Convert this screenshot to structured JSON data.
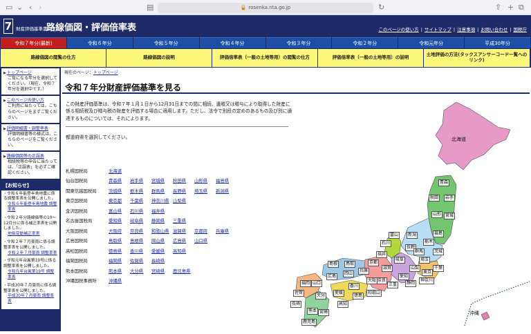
{
  "browser": {
    "url": "rosenka.nta.go.jp"
  },
  "header": {
    "logo_number": "7",
    "site_subtitle": "財産評価基準書",
    "site_title": "路線価図・評価倍率表",
    "util_links": [
      "このページの使い方",
      "サイトマップ",
      "注意事項",
      "お問い合わせ",
      "国税庁"
    ]
  },
  "year_tabs": [
    {
      "label": "令和７年分(最新)",
      "active": true
    },
    {
      "label": "令和６年分"
    },
    {
      "label": "令和５年分"
    },
    {
      "label": "令和４年分"
    },
    {
      "label": "令和３年分"
    },
    {
      "label": "令和２年分"
    },
    {
      "label": "令和元年分"
    },
    {
      "label": "平成30年分"
    }
  ],
  "menu": [
    "路線価図の閲覧の仕方",
    "路線価図の説明",
    "評価倍率表（一般の土地等用）の閲覧の仕方",
    "評価倍率表（一般の土地等用）の説明",
    "土地評価の方法(タックスアンサーコード一覧へのリンク)"
  ],
  "sidebar": {
    "boxes": [
      {
        "title": "トップページ",
        "desc": "ご覧になる年分を選択してください。（現在、令和７年分を選択中です。）"
      },
      {
        "title": "このページの使い方",
        "desc": "ご利用に当たっては、こちらのページをまずご覧ください。"
      },
      {
        "title": "評価明細書・調整率表",
        "desc": "評価明細書等の様式は、こちらのページをご覧ください。"
      },
      {
        "title": "路線価図等の正誤表",
        "desc": "相続税等の申告に当たっては、「正誤表」を必ずご確認ください。"
      }
    ],
    "news_heading": "【お知らせ】",
    "news": [
      {
        "text": "令和６年能登半島地震に係る調整率表を公開しました。",
        "link": "令和６年能登半島地震 調整率表"
      },
      {
        "text": "令和２年分路線価等の10～12月分に係る補正率表を公開しました。",
        "link": "地価変動補正率表"
      },
      {
        "text": "令和２年７月豪雨に係る調整率表を公開しました。",
        "link": "令和２年７月豪雨 調整率表"
      },
      {
        "text": "令和元年台風第19号に係る調整率表を公開しました。",
        "link": "令和元年台風第19号 調整率表"
      },
      {
        "text": "平成30年７月豪雨に係る調整率表を公開しました。",
        "link": "平成30年７月豪雨 調整率表"
      }
    ]
  },
  "main": {
    "breadcrumb_prefix": "現在のページ：",
    "breadcrumb_link": "トップページ",
    "title": "令和７年分財産評価基準を見る",
    "intro": "この財産評価基準は、令和７年１月１日から12月31日までの間に相続、遺贈又は贈与により取得した財産に係る相続税及び贈与税の財産を評価する場合に適用します。ただし、法令で別段の定めのあるもの及び別に通達するものについては、それによります。",
    "select_prompt": "都道府県を選択してください。"
  },
  "bureaus": [
    {
      "name": "札幌国税局",
      "prefs": [
        "北海道"
      ]
    },
    {
      "name": "仙台国税局",
      "prefs": [
        "青森県",
        "岩手県",
        "宮城県",
        "秋田県",
        "山形県",
        "福島県"
      ]
    },
    {
      "name": "関東信越国税局",
      "prefs": [
        "茨城県",
        "栃木県",
        "群馬県",
        "長野県",
        "埼玉県",
        "新潟県"
      ]
    },
    {
      "name": "東京国税局",
      "prefs": [
        "東京都",
        "千葉県",
        "神奈川県",
        "山梨県"
      ]
    },
    {
      "name": "金沢国税局",
      "prefs": [
        "富山県",
        "石川県",
        "福井県"
      ]
    },
    {
      "name": "名古屋国税局",
      "prefs": [
        "愛知県",
        "岐阜県",
        "静岡県",
        "三重県"
      ]
    },
    {
      "name": "大阪国税局",
      "prefs": [
        "大阪府",
        "奈良県",
        "和歌山県",
        "滋賀県",
        "京都府",
        "兵庫県"
      ]
    },
    {
      "name": "広島国税局",
      "prefs": [
        "鳥取県",
        "島根県",
        "岡山県",
        "広島県",
        "山口県"
      ]
    },
    {
      "name": "高松国税局",
      "prefs": [
        "徳島県",
        "香川県",
        "愛媛県",
        "高知県"
      ]
    },
    {
      "name": "福岡国税局",
      "prefs": [
        "福岡県",
        "佐賀県",
        "長崎県"
      ]
    },
    {
      "name": "熊本国税局",
      "prefs": [
        "熊本県",
        "大分県",
        "宮崎県",
        "鹿児島県"
      ]
    },
    {
      "name": "沖縄国税事務所",
      "prefs": [
        "沖縄県"
      ]
    }
  ],
  "map_labels": [
    "北海道",
    "青森",
    "秋田",
    "岩手",
    "山形",
    "宮城",
    "新潟",
    "福島",
    "富山",
    "石川",
    "長野",
    "栃木",
    "群馬",
    "茨城",
    "埼玉",
    "福井",
    "岐阜",
    "山梨",
    "千葉",
    "東京",
    "京都",
    "滋賀",
    "愛知",
    "静岡",
    "神奈川",
    "兵庫",
    "奈良",
    "三重",
    "大阪",
    "和歌山",
    "鳥取",
    "島根",
    "岡山",
    "広島",
    "山口",
    "香川",
    "徳島",
    "愛媛",
    "高知",
    "福岡",
    "佐賀",
    "長崎",
    "大分",
    "熊本",
    "宮崎",
    "鹿児島",
    "沖縄"
  ],
  "colors": {
    "navy": "#1d2b68",
    "tab_blue": "#1d4fa6",
    "tab_active": "#c21e1e",
    "menu_yellow": "#fdf77a",
    "sapporo": "#e79ac8",
    "sendai": "#73c56f",
    "kanto_shinetsu": "#b7ddf4",
    "tokyo": "#f3c46c",
    "kanazawa": "#b2d83c",
    "nagoya": "#c9a5dd",
    "osaka": "#f59c9c",
    "hiroshima": "#9cc8e6",
    "takamatsu": "#edd95a",
    "fukuoka": "#f4b683",
    "kumamoto": "#8fd49b",
    "okinawa": "#e67fb0"
  }
}
